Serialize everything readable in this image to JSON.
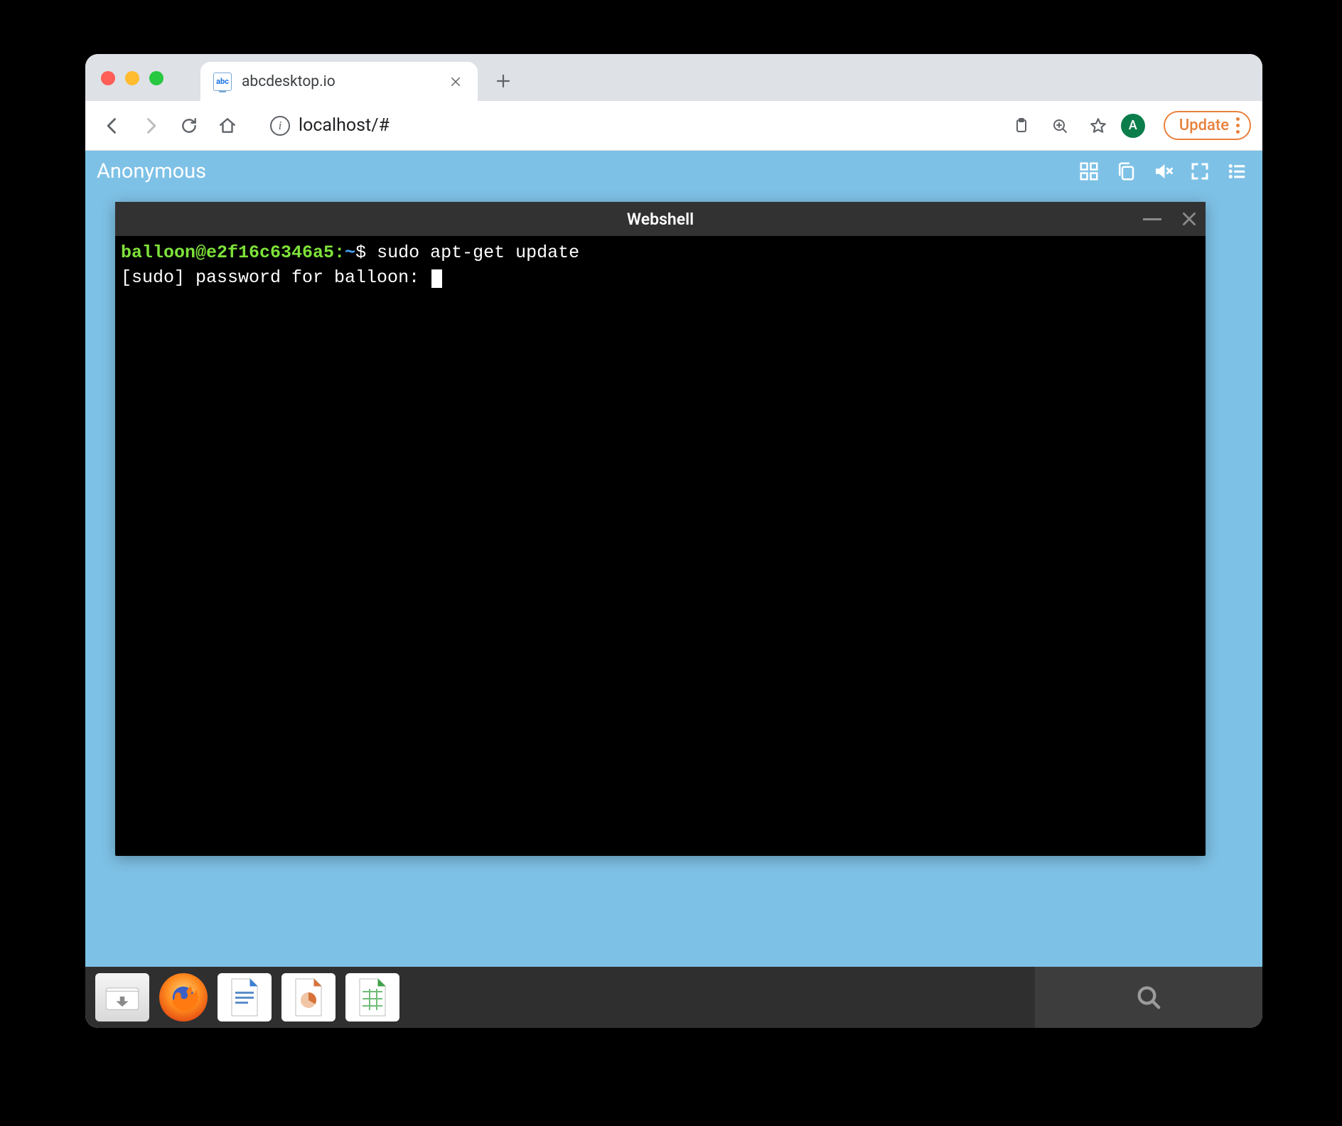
{
  "browser": {
    "tab": {
      "title": "abcdesktop.io",
      "favicon_text": "abc"
    },
    "url": "localhost/#",
    "update_label": "Update",
    "avatar_initial": "A",
    "nav": {
      "back": "Back",
      "forward": "Forward",
      "reload": "Reload",
      "home": "Home"
    }
  },
  "page": {
    "username": "Anonymous",
    "header_icons": [
      "grid-icon",
      "clipboard-icon",
      "mute-icon",
      "fullscreen-icon",
      "menu-icon"
    ]
  },
  "terminal": {
    "title": "Webshell",
    "prompt_user": "balloon@e2f16c6346a5",
    "prompt_sep": ":",
    "prompt_path": "~",
    "prompt_symbol": "$",
    "command": "sudo apt-get update",
    "line2": "[sudo] password for balloon: "
  },
  "dock": {
    "items": [
      "files-app-icon",
      "firefox-app-icon",
      "writer-app-icon",
      "impress-app-icon",
      "calc-app-icon"
    ]
  }
}
